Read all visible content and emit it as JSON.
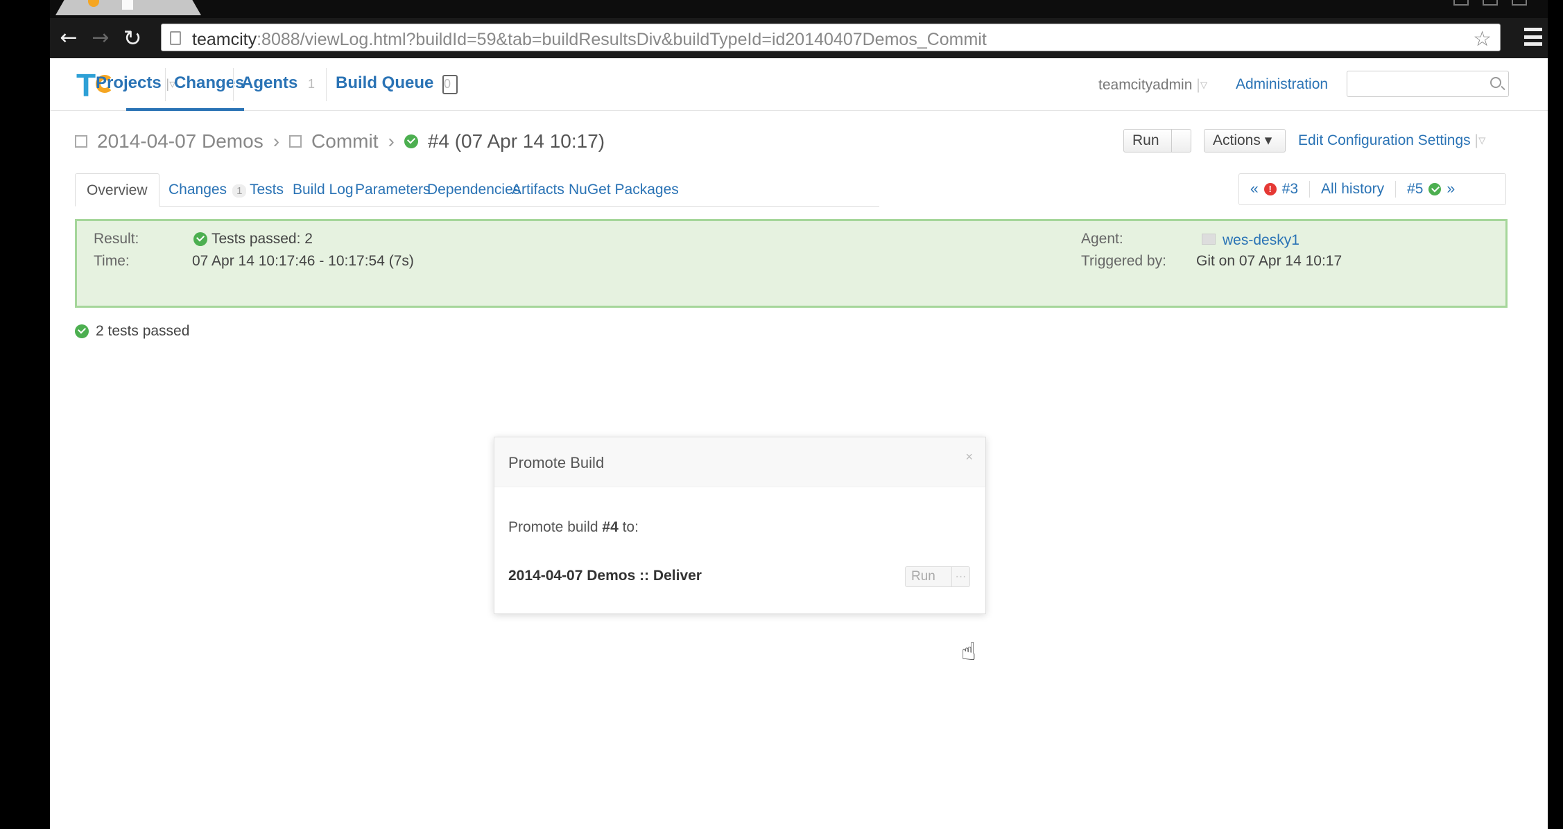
{
  "browser": {
    "url_host": "teamcity",
    "url_rest": ":8088/viewLog.html?buildId=59&tab=buildResultsDiv&buildTypeId=id20140407Demos_Commit"
  },
  "topnav": {
    "projects": "Projects",
    "changes": "Changes",
    "agents": "Agents",
    "agents_count": "1",
    "build_queue": "Build Queue",
    "queue_count": "0",
    "user": "teamcityadmin",
    "administration": "Administration"
  },
  "breadcrumb": {
    "project": "2014-04-07 Demos",
    "config": "Commit",
    "build": "#4 (07 Apr 14 10:17)"
  },
  "actions": {
    "run": "Run",
    "actions": "Actions ▾",
    "edit": "Edit Configuration Settings"
  },
  "tabs": [
    {
      "label": "Overview"
    },
    {
      "label": "Changes",
      "count": "1"
    },
    {
      "label": "Tests"
    },
    {
      "label": "Build Log"
    },
    {
      "label": "Parameters"
    },
    {
      "label": "Dependencies"
    },
    {
      "label": "Artifacts"
    },
    {
      "label": "NuGet Packages"
    }
  ],
  "history": {
    "prev": "«",
    "prev_build": "#3",
    "all": "All history",
    "next_build": "#5",
    "next": "»"
  },
  "result": {
    "result_label": "Result:",
    "result_value": "Tests passed: 2",
    "time_label": "Time:",
    "time_value": "07 Apr 14 10:17:46 - 10:17:54 (7s)",
    "agent_label": "Agent:",
    "agent_value": "wes-desky1",
    "triggered_label": "Triggered by:",
    "triggered_value": "Git on 07 Apr 14 10:17"
  },
  "tests_summary": "2 tests passed",
  "dialog": {
    "title": "Promote Build",
    "close": "×",
    "text_prefix": "Promote build ",
    "build": "#4",
    "text_suffix": " to:",
    "target": "2014-04-07 Demos :: Deliver",
    "run": "Run",
    "more": "..."
  },
  "colors": {
    "link": "#2a73b5",
    "success": "#4caf50",
    "result_bg": "#e6f2e0",
    "error": "#e53935"
  }
}
